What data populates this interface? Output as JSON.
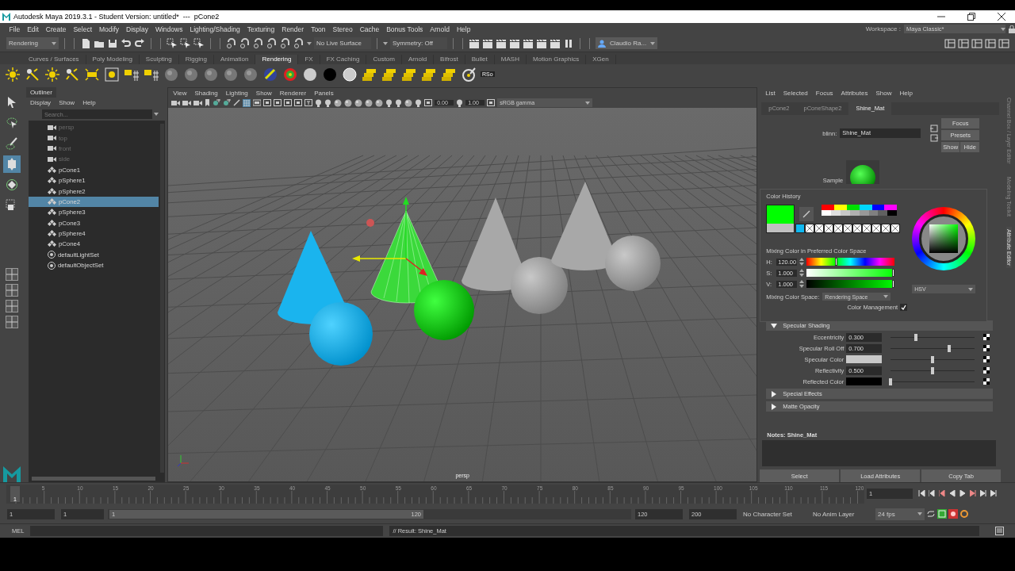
{
  "window": {
    "title": "Autodesk Maya 2019.3.1 - Student Version: untitled*  ---  pCone2"
  },
  "menu_bar": [
    "File",
    "Edit",
    "Create",
    "Select",
    "Modify",
    "Display",
    "Windows",
    "Lighting/Shading",
    "Texturing",
    "Render",
    "Toon",
    "Stereo",
    "Cache",
    "Bonus Tools",
    "Arnold",
    "Help"
  ],
  "workspace": {
    "label": "Workspace :",
    "value": "Maya Classic*"
  },
  "status_line": {
    "menu_set": "Rendering",
    "live_surface": "No Live Surface",
    "symmetry": "Symmetry: Off",
    "account": "Claudio Ra..."
  },
  "shelf_tabs": [
    {
      "label": "Curves / Surfaces",
      "selected": false
    },
    {
      "label": "Poly Modeling",
      "selected": false
    },
    {
      "label": "Sculpting",
      "selected": false
    },
    {
      "label": "Rigging",
      "selected": false
    },
    {
      "label": "Animation",
      "selected": false
    },
    {
      "label": "Rendering",
      "selected": true
    },
    {
      "label": "FX",
      "selected": false
    },
    {
      "label": "FX Caching",
      "selected": false
    },
    {
      "label": "Custom",
      "selected": false
    },
    {
      "label": "Arnold",
      "selected": false
    },
    {
      "label": "Bifrost",
      "selected": false
    },
    {
      "label": "Bullet",
      "selected": false
    },
    {
      "label": "MASH",
      "selected": false
    },
    {
      "label": "Motion Graphics",
      "selected": false
    },
    {
      "label": "XGen",
      "selected": false
    }
  ],
  "shelf": {
    "last_button_label": "RSo"
  },
  "tools": [
    {
      "selected": false
    },
    {
      "selected": false
    },
    {
      "selected": false
    },
    {
      "selected": true
    },
    {
      "selected": false
    },
    {
      "selected": false
    }
  ],
  "outliner": {
    "title": "Outliner",
    "menu": [
      "Display",
      "Show",
      "Help"
    ],
    "search": {
      "placeholder": "Search..."
    },
    "items": [
      {
        "label": "persp",
        "kind": "camera",
        "selected": false
      },
      {
        "label": "top",
        "kind": "camera",
        "selected": false
      },
      {
        "label": "front",
        "kind": "camera",
        "selected": false
      },
      {
        "label": "side",
        "kind": "camera",
        "selected": false
      },
      {
        "label": "pCone1",
        "kind": "transform",
        "selected": false
      },
      {
        "label": "pSphere1",
        "kind": "transform",
        "selected": false
      },
      {
        "label": "pSphere2",
        "kind": "transform",
        "selected": false
      },
      {
        "label": "pCone2",
        "kind": "transform",
        "selected": true
      },
      {
        "label": "pSphere3",
        "kind": "transform",
        "selected": false
      },
      {
        "label": "pCone3",
        "kind": "transform",
        "selected": false
      },
      {
        "label": "pSphere4",
        "kind": "transform",
        "selected": false
      },
      {
        "label": "pCone4",
        "kind": "transform",
        "selected": false
      },
      {
        "label": "defaultLightSet",
        "kind": "set",
        "selected": false
      },
      {
        "label": "defaultObjectSet",
        "kind": "set",
        "selected": false
      }
    ]
  },
  "viewport": {
    "menu": [
      "View",
      "Shading",
      "Lighting",
      "Show",
      "Renderer",
      "Panels"
    ],
    "exposure": "0.00",
    "gamma": "1.00",
    "color_space": "sRGB gamma",
    "camera_label": "persp"
  },
  "attribute_editor": {
    "menu": [
      "List",
      "Selected",
      "Focus",
      "Attributes",
      "Show",
      "Help"
    ],
    "tabs": [
      {
        "label": "pCone2",
        "selected": false
      },
      {
        "label": "pConeShape2",
        "selected": false
      },
      {
        "label": "Shine_Mat",
        "selected": true
      }
    ],
    "node_type": "blinn:",
    "node_name": "Shine_Mat",
    "buttons": [
      "Focus",
      "Presets",
      "Show",
      "Hide"
    ],
    "sample_label": "Sample",
    "sections": [
      {
        "label": "Specular Shading",
        "expanded": true,
        "attributes": [
          {
            "label": "Eccentricity",
            "kind": "number",
            "value": "0.300",
            "level": 0.3
          },
          {
            "label": "Specular Roll Off",
            "kind": "number",
            "value": "0.700",
            "level": 0.7
          },
          {
            "label": "Specular Color",
            "kind": "color",
            "color": "#c8c8c8",
            "level": 0.5
          },
          {
            "label": "Reflectivity",
            "kind": "number",
            "value": "0.500",
            "level": 0.5
          },
          {
            "label": "Reflected Color",
            "kind": "color",
            "color": "#000000",
            "level": 0
          }
        ]
      },
      {
        "label": "Special Effects",
        "expanded": false
      },
      {
        "label": "Matte Opacity",
        "expanded": false
      }
    ],
    "notes_label": "Notes:  Shine_Mat",
    "footer_buttons": [
      "Select",
      "Load Attributes",
      "Copy Tab"
    ]
  },
  "color_chooser": {
    "title": "Color History",
    "current": {
      "color": "#00ff00"
    },
    "previous": {
      "color": "#c0c0c0"
    },
    "history_top": [
      {
        "color": "#ff0000"
      },
      {
        "color": "#ffff00"
      },
      {
        "color": "#00e000"
      },
      {
        "color": "#00d8ff"
      },
      {
        "color": "#0000ff"
      },
      {
        "color": "#ff00ff"
      }
    ],
    "history_bottom": [
      {
        "color": "#ffffff"
      },
      {
        "color": "#e0e0e0"
      },
      {
        "color": "#c8c8c8"
      },
      {
        "color": "#b0b0b0"
      },
      {
        "color": "#989898"
      },
      {
        "color": "#808080"
      },
      {
        "color": "#606060"
      },
      {
        "color": "#000000"
      }
    ],
    "recent": [
      {
        "kind": "color",
        "color": "#10b8f0"
      },
      {
        "kind": "empty"
      },
      {
        "kind": "empty"
      },
      {
        "kind": "empty"
      },
      {
        "kind": "empty"
      },
      {
        "kind": "empty"
      },
      {
        "kind": "empty"
      },
      {
        "kind": "empty"
      },
      {
        "kind": "empty"
      },
      {
        "kind": "empty"
      },
      {
        "kind": "empty"
      }
    ],
    "section": "Mixing Color in Preferred Color Space",
    "channels": [
      {
        "label": "H:",
        "kind": "hue",
        "value": "120.00",
        "level": 0.333
      },
      {
        "label": "S:",
        "kind": "saturation",
        "value": "1.000",
        "level": 1
      },
      {
        "label": "V:",
        "kind": "value",
        "value": "1.000",
        "level": 1
      }
    ],
    "mixing_label": "Mixing Color Space:",
    "mixing_value": "Rendering Space",
    "color_management": {
      "label": "Color Management",
      "checked": true
    },
    "mode": "HSV"
  },
  "side_tabs": [
    {
      "label": "Channel Box / Layer Editor",
      "selected": false
    },
    {
      "label": "Modeling Toolkit",
      "selected": false
    },
    {
      "label": "Attribute Editor",
      "selected": true
    }
  ],
  "time_slider": {
    "current_frame": "1",
    "tick_labels": [
      "5",
      "10",
      "15",
      "20",
      "25",
      "30",
      "35",
      "40",
      "45",
      "50",
      "55",
      "60",
      "65",
      "70",
      "75",
      "80",
      "85",
      "90",
      "95",
      "100",
      "105",
      "110",
      "115",
      "120"
    ],
    "frame_field": "1"
  },
  "range_slider": {
    "start": "1",
    "inner_start": "1",
    "range_start": "1",
    "range_end": "120",
    "inner_end": "120",
    "end": "200",
    "level": 0.6,
    "character_set": "No Character Set",
    "anim_layer": "No Anim Layer",
    "fps": "24 fps"
  },
  "command_line": {
    "mode": "MEL",
    "result": "// Result: Shine_Mat"
  }
}
